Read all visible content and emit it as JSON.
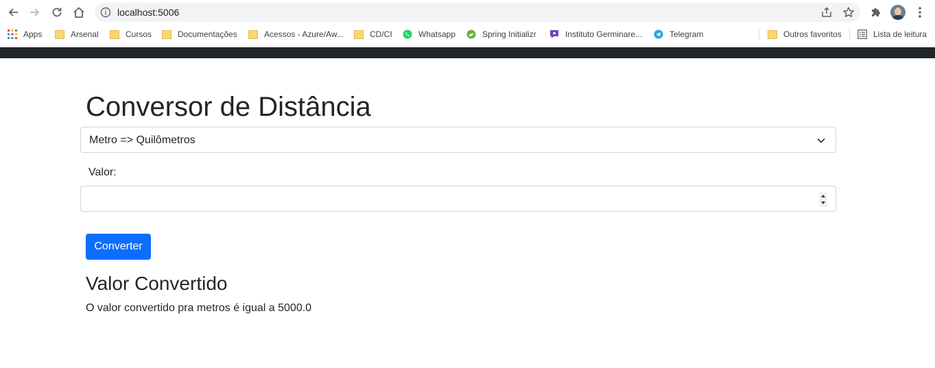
{
  "browser": {
    "url": "localhost:5006",
    "bookmarks": [
      {
        "label": "Apps",
        "icon": "apps-grid-icon"
      },
      {
        "label": "Arsenal",
        "icon": "folder-icon"
      },
      {
        "label": "Cursos",
        "icon": "folder-icon"
      },
      {
        "label": "Documentações",
        "icon": "folder-icon"
      },
      {
        "label": "Acessos - Azure/Aw...",
        "icon": "folder-icon"
      },
      {
        "label": "CD/CI",
        "icon": "folder-icon"
      },
      {
        "label": "Whatsapp",
        "icon": "whatsapp-icon"
      },
      {
        "label": "Spring Initializr",
        "icon": "spring-icon"
      },
      {
        "label": "Instituto Germinare...",
        "icon": "germinare-icon"
      },
      {
        "label": "Telegram",
        "icon": "telegram-icon"
      }
    ],
    "other_bookmarks": {
      "label": "Outros favoritos",
      "icon": "folder-icon"
    },
    "reading_list": {
      "label": "Lista de leitura",
      "icon": "reading-list-icon"
    }
  },
  "page": {
    "title": "Conversor de Distância",
    "select_value": "Metro => Quilômetros",
    "value_label": "Valor:",
    "value_input": "",
    "convert_button": "Converter",
    "result_heading": "Valor Convertido",
    "result_text": "O valor convertido pra metros é igual a 5000.0"
  },
  "colors": {
    "primary": "#0d6efd",
    "navbar": "#212529",
    "text": "#212529",
    "border": "#ced4da"
  }
}
